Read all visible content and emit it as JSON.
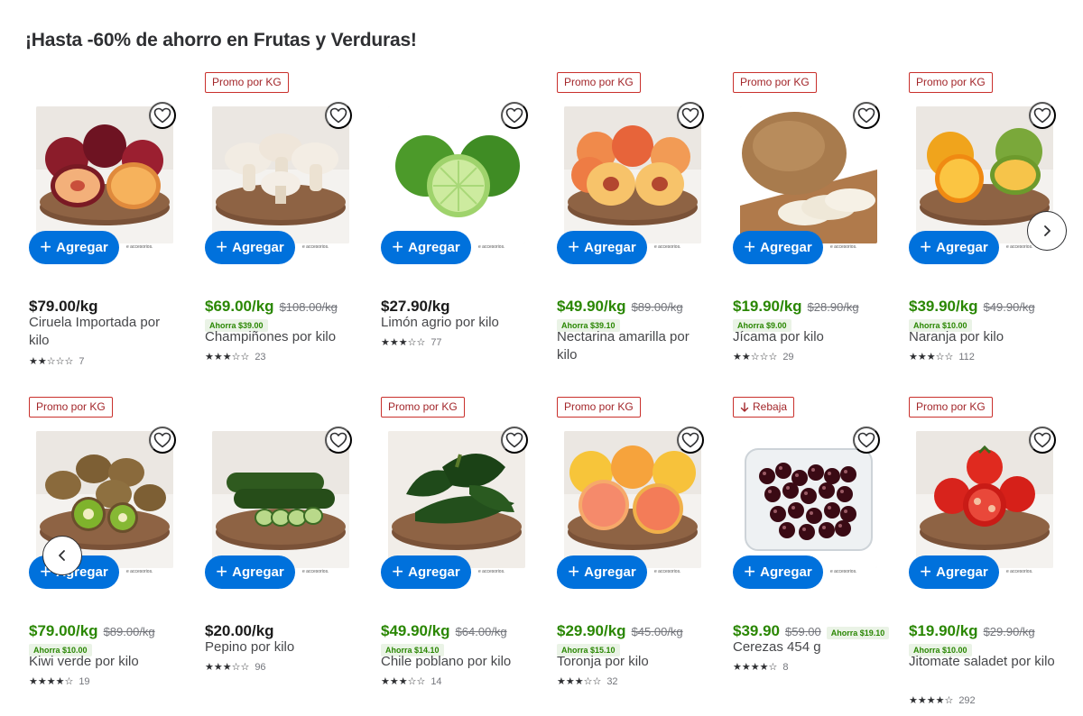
{
  "section_title": "¡Hasta -60% de ahorro en Frutas y Verduras!",
  "add_label": "Agregar",
  "fine_print": "e accesorios.",
  "colors": {
    "accent": "#0071dc",
    "promo_price": "#2a8703",
    "badge_border": "#c9302c"
  },
  "icons": {
    "favorite": "heart-outline-icon",
    "add": "plus-icon",
    "next": "chevron-right-icon",
    "prev": "chevron-left-icon",
    "rebaja": "arrow-down-icon"
  },
  "products": [
    {
      "badge": "",
      "price": "$79.00/kg",
      "was": "",
      "save": "",
      "name": "Ciruela Importada por kilo",
      "stars": "★★☆☆☆",
      "rating": 2.5,
      "reviews": "7",
      "image": "plum"
    },
    {
      "badge": "Promo por KG",
      "price": "$69.00/kg",
      "was": "$108.00/kg",
      "save": "Ahorra $39.00",
      "name": "Champiñones por kilo",
      "stars": "★★★☆☆",
      "rating": 3.5,
      "reviews": "23",
      "image": "mushroom"
    },
    {
      "badge": "",
      "price": "$27.90/kg",
      "was": "",
      "save": "",
      "name": "Limón agrio por kilo",
      "stars": "★★★☆☆",
      "rating": 3,
      "reviews": "77",
      "image": "lime"
    },
    {
      "badge": "Promo por KG",
      "price": "$49.90/kg",
      "was": "$89.00/kg",
      "save": "Ahorra $39.10",
      "name": "Nectarina amarilla por kilo",
      "stars": "",
      "rating": 0,
      "reviews": "",
      "image": "nectarine"
    },
    {
      "badge": "Promo por KG",
      "price": "$19.90/kg",
      "was": "$28.90/kg",
      "save": "Ahorra $9.00",
      "name": "Jícama por kilo",
      "stars": "★★☆☆☆",
      "rating": 2.5,
      "reviews": "29",
      "image": "jicama"
    },
    {
      "badge": "Promo por KG",
      "price": "$39.90/kg",
      "was": "$49.90/kg",
      "save": "Ahorra $10.00",
      "name": "Naranja por kilo",
      "stars": "★★★☆☆",
      "rating": 3,
      "reviews": "112",
      "image": "orange"
    },
    {
      "badge": "Promo por KG",
      "price": "$79.00/kg",
      "was": "$89.00/kg",
      "save": "Ahorra $10.00",
      "name": "Kiwi verde por kilo",
      "stars": "★★★★☆",
      "rating": 4,
      "reviews": "19",
      "image": "kiwi"
    },
    {
      "badge": "",
      "price": "$20.00/kg",
      "was": "",
      "save": "",
      "name": "Pepino por kilo",
      "stars": "★★★☆☆",
      "rating": 3,
      "reviews": "96",
      "image": "cucumber"
    },
    {
      "badge": "Promo por KG",
      "price": "$49.90/kg",
      "was": "$64.00/kg",
      "save": "Ahorra $14.10",
      "name": "Chile poblano por kilo",
      "stars": "★★★☆☆",
      "rating": 3.5,
      "reviews": "14",
      "image": "poblano"
    },
    {
      "badge": "Promo por KG",
      "price": "$29.90/kg",
      "was": "$45.00/kg",
      "save": "Ahorra $15.10",
      "name": "Toronja por kilo",
      "stars": "★★★☆☆",
      "rating": 3,
      "reviews": "32",
      "image": "grapefruit"
    },
    {
      "badge": "Rebaja",
      "price": "$39.90",
      "was": "$59.00",
      "save": "Ahorra $19.10",
      "name": "Cerezas 454 g",
      "stars": "★★★★☆",
      "rating": 4.5,
      "reviews": "8",
      "image": "cherries"
    },
    {
      "badge": "Promo por KG",
      "price": "$19.90/kg",
      "was": "$29.90/kg",
      "save": "Ahorra $10.00",
      "name": "Jitomate saladet por kilo",
      "stars": "★★★★☆",
      "rating": 4,
      "reviews": "292",
      "image": "tomato"
    }
  ]
}
